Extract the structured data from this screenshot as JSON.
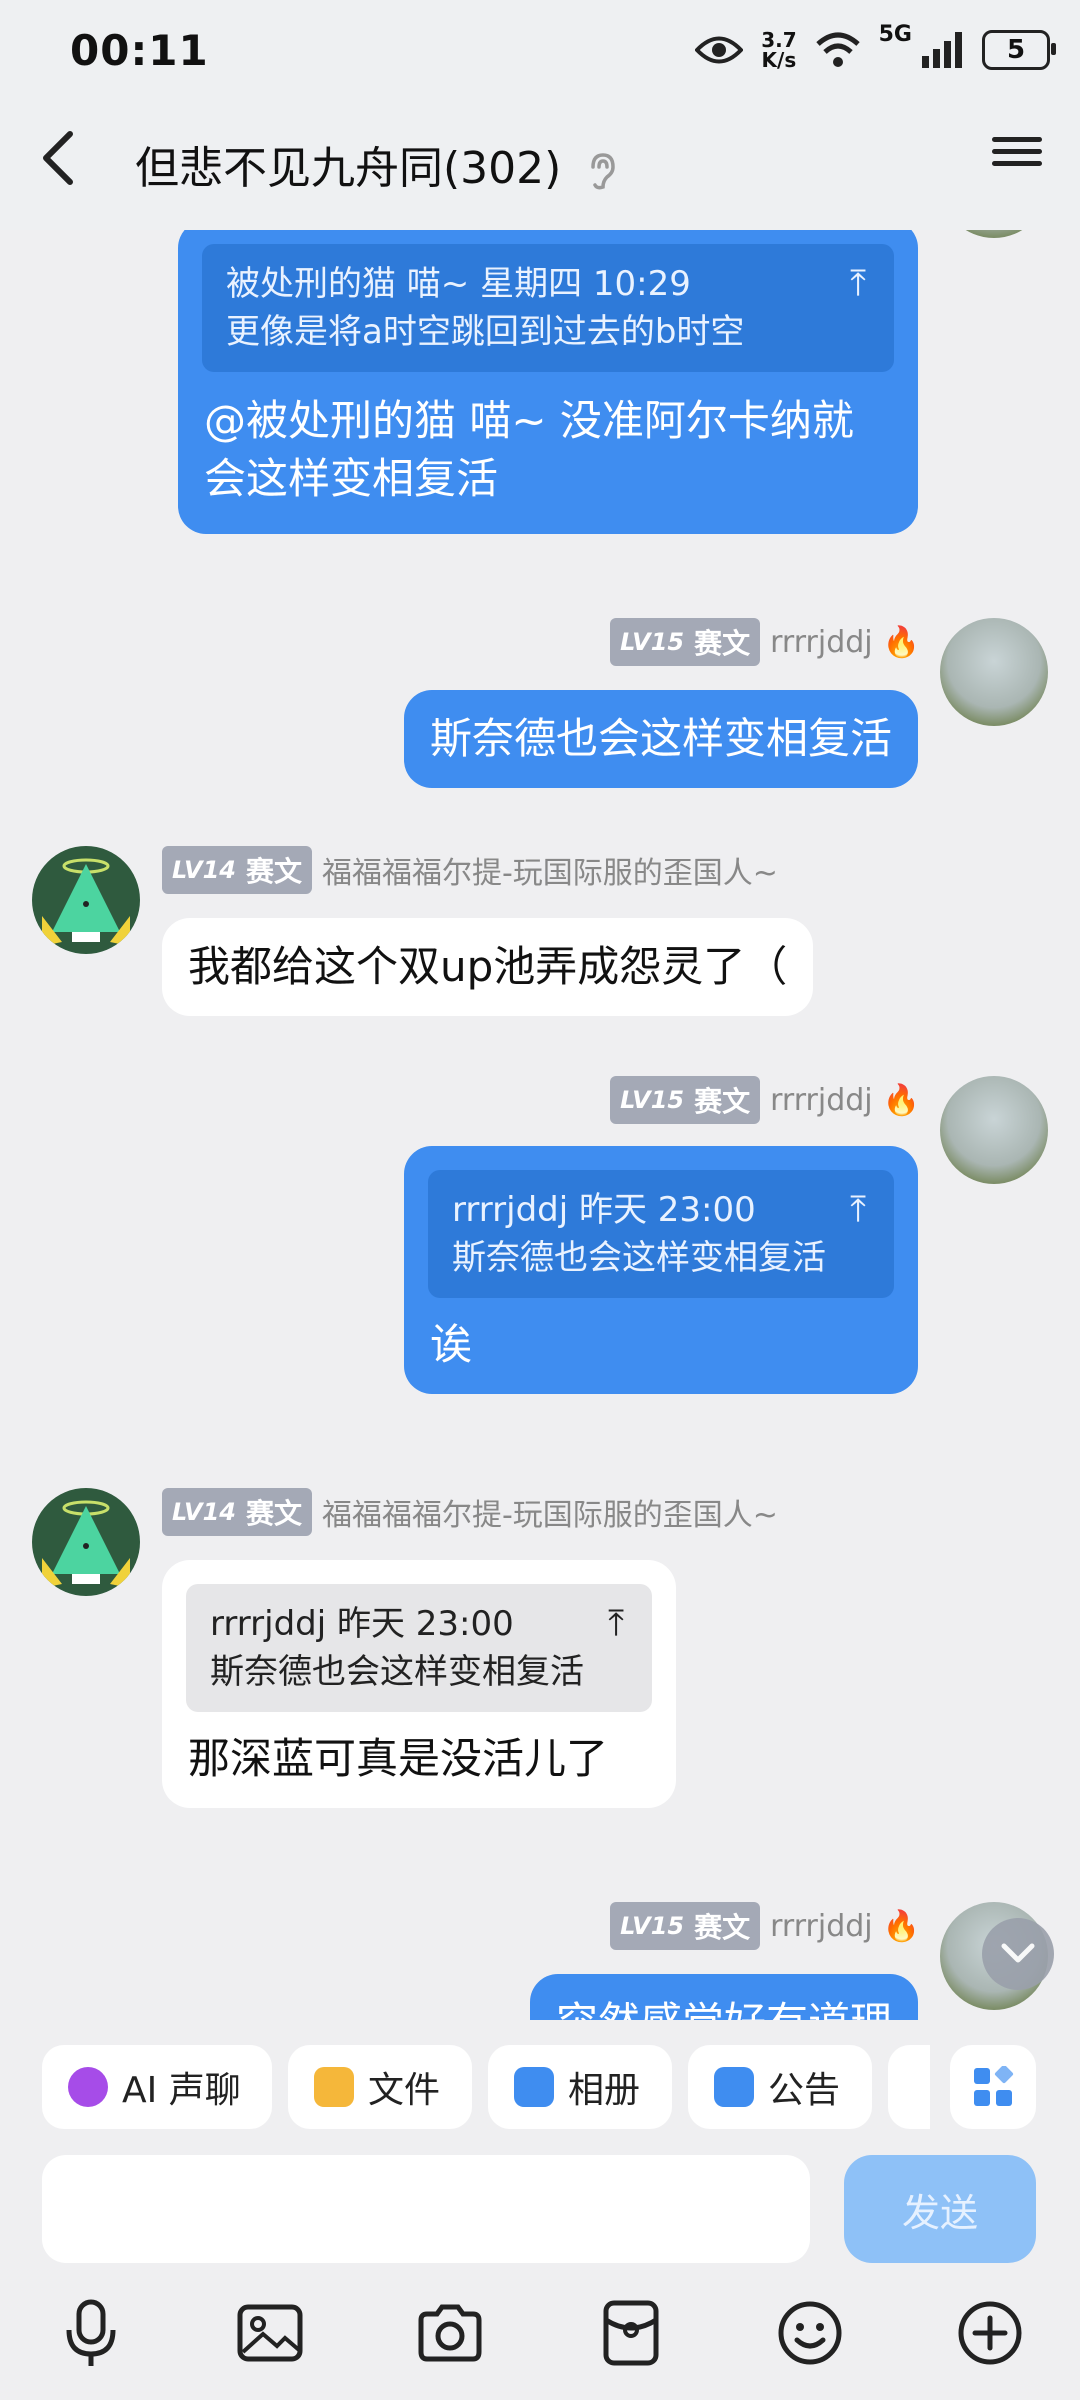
{
  "status_bar": {
    "time": "00:11",
    "net_speed_value": "3.7",
    "net_speed_unit": "K/s",
    "network": "5G",
    "battery": "5",
    "icons": [
      "eye-icon",
      "wifi-icon",
      "signal-icon",
      "battery-icon"
    ]
  },
  "header": {
    "back_icon": "chevron-left-icon",
    "title": "但悲不见九舟同(302)",
    "ear_icon": "ear-icon",
    "menu_icon": "menu-icon"
  },
  "messages": [
    {
      "side": "out",
      "quote_header": "被处刑的猫 喵~ 星期四 10:29",
      "quote_text": "更像是将a时空跳回到过去的b时空",
      "text": "@被处刑的猫 喵~ 没准阿尔卡纳就会这样变相复活"
    },
    {
      "side": "out",
      "badge_level": "LV15",
      "badge_title": "赛文",
      "name": "rrrrjddj",
      "text": "斯奈德也会这样变相复活"
    },
    {
      "side": "in",
      "badge_level": "LV14",
      "badge_title": "赛文",
      "name": "福福福福尔提-玩国际服的歪国人~",
      "text": "我都给这个双up池弄成怨灵了（"
    },
    {
      "side": "out",
      "badge_level": "LV15",
      "badge_title": "赛文",
      "name": "rrrrjddj",
      "quote_header": "rrrrjddj 昨天 23:00",
      "quote_text": "斯奈德也会这样变相复活",
      "text": "诶"
    },
    {
      "side": "in",
      "badge_level": "LV14",
      "badge_title": "赛文",
      "name": "福福福福尔提-玩国际服的歪国人~",
      "quote_header": "rrrrjddj 昨天 23:00",
      "quote_text": "斯奈德也会这样变相复活",
      "text": "那深蓝可真是没活儿了"
    },
    {
      "side": "out",
      "badge_level": "LV15",
      "badge_title": "赛文",
      "name": "rrrrjddj",
      "text": "突然感觉好有道理"
    }
  ],
  "quick_actions": [
    {
      "label": "AI 声聊",
      "icon": "ai-voice-icon",
      "color": "#a64ce8"
    },
    {
      "label": "文件",
      "icon": "folder-icon",
      "color": "#f5b73a"
    },
    {
      "label": "相册",
      "icon": "album-icon",
      "color": "#3f8df0"
    },
    {
      "label": "公告",
      "icon": "announcement-icon",
      "color": "#3f8df0"
    }
  ],
  "input": {
    "value": "",
    "send_label": "发送"
  },
  "bottom_bar": [
    "microphone-icon",
    "image-icon",
    "camera-icon",
    "red-packet-icon",
    "emoji-icon",
    "plus-icon"
  ],
  "colors": {
    "out_bubble": "#3f8df0",
    "in_bubble": "#ffffff",
    "background": "#efeff1",
    "send_button": "#8ec1f7"
  }
}
